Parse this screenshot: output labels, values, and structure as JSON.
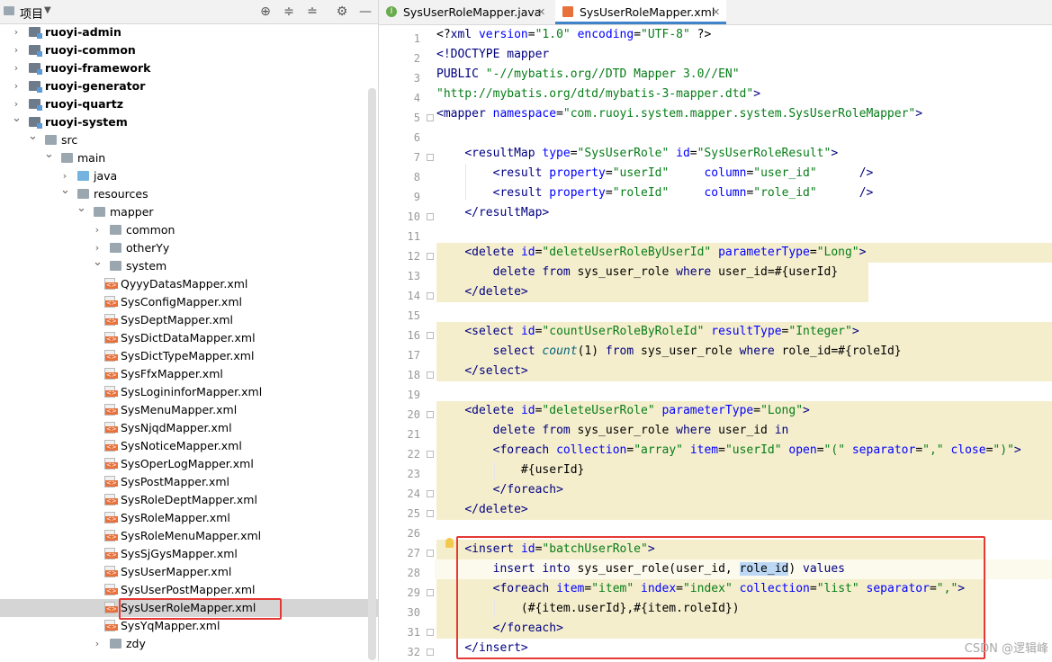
{
  "project_panel": {
    "title": "项目",
    "toolbar_icons": [
      "locate-icon",
      "expand-all-icon",
      "collapse-all-icon",
      "settings-icon",
      "hide-icon"
    ],
    "tree": [
      {
        "label": "ruoyi-admin",
        "level": 0,
        "kind": "module",
        "arrow": "right",
        "bold": true
      },
      {
        "label": "ruoyi-common",
        "level": 0,
        "kind": "module",
        "arrow": "right",
        "bold": true
      },
      {
        "label": "ruoyi-framework",
        "level": 0,
        "kind": "module",
        "arrow": "right",
        "bold": true
      },
      {
        "label": "ruoyi-generator",
        "level": 0,
        "kind": "module",
        "arrow": "right",
        "bold": true
      },
      {
        "label": "ruoyi-quartz",
        "level": 0,
        "kind": "module",
        "arrow": "right",
        "bold": true
      },
      {
        "label": "ruoyi-system",
        "level": 0,
        "kind": "module",
        "arrow": "down",
        "bold": true
      },
      {
        "label": "src",
        "level": 1,
        "kind": "folder",
        "arrow": "down"
      },
      {
        "label": "main",
        "level": 2,
        "kind": "folder",
        "arrow": "down"
      },
      {
        "label": "java",
        "level": 3,
        "kind": "folder-blue",
        "arrow": "right"
      },
      {
        "label": "resources",
        "level": 3,
        "kind": "folder-res",
        "arrow": "down"
      },
      {
        "label": "mapper",
        "level": 4,
        "kind": "folder",
        "arrow": "down"
      },
      {
        "label": "common",
        "level": 5,
        "kind": "folder",
        "arrow": "right"
      },
      {
        "label": "otherYy",
        "level": 5,
        "kind": "folder",
        "arrow": "right"
      },
      {
        "label": "system",
        "level": 5,
        "kind": "folder",
        "arrow": "down"
      },
      {
        "label": "QyyyDatasMapper.xml",
        "level": 6,
        "kind": "xml"
      },
      {
        "label": "SysConfigMapper.xml",
        "level": 6,
        "kind": "xml"
      },
      {
        "label": "SysDeptMapper.xml",
        "level": 6,
        "kind": "xml"
      },
      {
        "label": "SysDictDataMapper.xml",
        "level": 6,
        "kind": "xml"
      },
      {
        "label": "SysDictTypeMapper.xml",
        "level": 6,
        "kind": "xml"
      },
      {
        "label": "SysFfxMapper.xml",
        "level": 6,
        "kind": "xml"
      },
      {
        "label": "SysLogininforMapper.xml",
        "level": 6,
        "kind": "xml"
      },
      {
        "label": "SysMenuMapper.xml",
        "level": 6,
        "kind": "xml"
      },
      {
        "label": "SysNjqdMapper.xml",
        "level": 6,
        "kind": "xml"
      },
      {
        "label": "SysNoticeMapper.xml",
        "level": 6,
        "kind": "xml"
      },
      {
        "label": "SysOperLogMapper.xml",
        "level": 6,
        "kind": "xml"
      },
      {
        "label": "SysPostMapper.xml",
        "level": 6,
        "kind": "xml"
      },
      {
        "label": "SysRoleDeptMapper.xml",
        "level": 6,
        "kind": "xml"
      },
      {
        "label": "SysRoleMapper.xml",
        "level": 6,
        "kind": "xml"
      },
      {
        "label": "SysRoleMenuMapper.xml",
        "level": 6,
        "kind": "xml"
      },
      {
        "label": "SysSjGysMapper.xml",
        "level": 6,
        "kind": "xml"
      },
      {
        "label": "SysUserMapper.xml",
        "level": 6,
        "kind": "xml"
      },
      {
        "label": "SysUserPostMapper.xml",
        "level": 6,
        "kind": "xml"
      },
      {
        "label": "SysUserRoleMapper.xml",
        "level": 6,
        "kind": "xml",
        "selected": true
      },
      {
        "label": "SysYqMapper.xml",
        "level": 6,
        "kind": "xml"
      },
      {
        "label": "zdy",
        "level": 5,
        "kind": "folder",
        "arrow": "right"
      }
    ]
  },
  "tabs": [
    {
      "label": "SysUserRoleMapper.java",
      "icon": "java-class-icon",
      "active": false
    },
    {
      "label": "SysUserRoleMapper.xml",
      "icon": "xml-file-icon",
      "active": true
    }
  ],
  "code": [
    [
      [
        "pl",
        "<?"
      ],
      [
        "tag",
        "xml "
      ],
      [
        "attr",
        "version"
      ],
      [
        "pl",
        "="
      ],
      [
        "val",
        "\"1.0\""
      ],
      [
        "pl",
        " "
      ],
      [
        "attr",
        "encoding"
      ],
      [
        "pl",
        "="
      ],
      [
        "val",
        "\"UTF-8\""
      ],
      [
        "pl",
        " ?>"
      ]
    ],
    [
      [
        "tag",
        "<!DOCTYPE "
      ],
      [
        "tag",
        "mapper"
      ]
    ],
    [
      [
        "tag",
        "PUBLIC "
      ],
      [
        "val",
        "\"-//mybatis.org//DTD Mapper 3.0//EN\""
      ]
    ],
    [
      [
        "val",
        "\"http://mybatis.org/dtd/mybatis-3-mapper.dtd\""
      ],
      [
        "tag",
        ">"
      ]
    ],
    [
      [
        "tag",
        "<mapper "
      ],
      [
        "attr",
        "namespace"
      ],
      [
        "pl",
        "="
      ],
      [
        "val",
        "\"com.ruoyi.system.mapper.system.SysUserRoleMapper\""
      ],
      [
        "tag",
        ">"
      ]
    ],
    [],
    [
      [
        "pl",
        "    "
      ],
      [
        "tag",
        "<resultMap "
      ],
      [
        "attr",
        "type"
      ],
      [
        "pl",
        "="
      ],
      [
        "val",
        "\"SysUserRole\""
      ],
      [
        "pl",
        " "
      ],
      [
        "attr",
        "id"
      ],
      [
        "pl",
        "="
      ],
      [
        "val",
        "\"SysUserRoleResult\""
      ],
      [
        "tag",
        ">"
      ]
    ],
    [
      [
        "pl",
        "        "
      ],
      [
        "tag",
        "<result "
      ],
      [
        "attr",
        "property"
      ],
      [
        "pl",
        "="
      ],
      [
        "val",
        "\"userId\""
      ],
      [
        "pl",
        "     "
      ],
      [
        "attr",
        "column"
      ],
      [
        "pl",
        "="
      ],
      [
        "val",
        "\"user_id\""
      ],
      [
        "pl",
        "      "
      ],
      [
        "tag",
        "/>"
      ]
    ],
    [
      [
        "pl",
        "        "
      ],
      [
        "tag",
        "<result "
      ],
      [
        "attr",
        "property"
      ],
      [
        "pl",
        "="
      ],
      [
        "val",
        "\"roleId\""
      ],
      [
        "pl",
        "     "
      ],
      [
        "attr",
        "column"
      ],
      [
        "pl",
        "="
      ],
      [
        "val",
        "\"role_id\""
      ],
      [
        "pl",
        "      "
      ],
      [
        "tag",
        "/>"
      ]
    ],
    [
      [
        "pl",
        "    "
      ],
      [
        "tag",
        "</resultMap>"
      ]
    ],
    [],
    [
      [
        "pl",
        "    "
      ],
      [
        "tag",
        "<delete "
      ],
      [
        "attr",
        "id"
      ],
      [
        "pl",
        "="
      ],
      [
        "val",
        "\"deleteUserRoleByUserId\""
      ],
      [
        "pl",
        " "
      ],
      [
        "attr",
        "parameterType"
      ],
      [
        "pl",
        "="
      ],
      [
        "val",
        "\"Long\""
      ],
      [
        "tag",
        ">"
      ]
    ],
    [
      [
        "pl",
        "        "
      ],
      [
        "kw",
        "delete from "
      ],
      [
        "pl",
        "sys_user_role "
      ],
      [
        "kw",
        "where "
      ],
      [
        "pl",
        "user_id=#{userId}"
      ]
    ],
    [
      [
        "pl",
        "    "
      ],
      [
        "tag",
        "</delete>"
      ]
    ],
    [],
    [
      [
        "pl",
        "    "
      ],
      [
        "tag",
        "<select "
      ],
      [
        "attr",
        "id"
      ],
      [
        "pl",
        "="
      ],
      [
        "val",
        "\"countUserRoleByRoleId\""
      ],
      [
        "pl",
        " "
      ],
      [
        "attr",
        "resultType"
      ],
      [
        "pl",
        "="
      ],
      [
        "val",
        "\"Integer\""
      ],
      [
        "tag",
        ">"
      ]
    ],
    [
      [
        "pl",
        "        "
      ],
      [
        "kw",
        "select "
      ],
      [
        "fn",
        "count"
      ],
      [
        "pl",
        "(1) "
      ],
      [
        "kw",
        "from "
      ],
      [
        "pl",
        "sys_user_role "
      ],
      [
        "kw",
        "where "
      ],
      [
        "pl",
        "role_id=#{roleId}"
      ]
    ],
    [
      [
        "pl",
        "    "
      ],
      [
        "tag",
        "</select>"
      ]
    ],
    [],
    [
      [
        "pl",
        "    "
      ],
      [
        "tag",
        "<delete "
      ],
      [
        "attr",
        "id"
      ],
      [
        "pl",
        "="
      ],
      [
        "val",
        "\"deleteUserRole\""
      ],
      [
        "pl",
        " "
      ],
      [
        "attr",
        "parameterType"
      ],
      [
        "pl",
        "="
      ],
      [
        "val",
        "\"Long\""
      ],
      [
        "tag",
        ">"
      ]
    ],
    [
      [
        "pl",
        "        "
      ],
      [
        "kw",
        "delete from "
      ],
      [
        "pl",
        "sys_user_role "
      ],
      [
        "kw",
        "where "
      ],
      [
        "pl",
        "user_id "
      ],
      [
        "kw",
        "in"
      ]
    ],
    [
      [
        "pl",
        "        "
      ],
      [
        "tag",
        "<foreach "
      ],
      [
        "attr",
        "collection"
      ],
      [
        "pl",
        "="
      ],
      [
        "val",
        "\"array\""
      ],
      [
        "pl",
        " "
      ],
      [
        "attr",
        "item"
      ],
      [
        "pl",
        "="
      ],
      [
        "val",
        "\"userId\""
      ],
      [
        "pl",
        " "
      ],
      [
        "attr",
        "open"
      ],
      [
        "pl",
        "="
      ],
      [
        "val",
        "\"(\""
      ],
      [
        "pl",
        " "
      ],
      [
        "attr",
        "separator"
      ],
      [
        "pl",
        "="
      ],
      [
        "val",
        "\",\""
      ],
      [
        "pl",
        " "
      ],
      [
        "attr",
        "close"
      ],
      [
        "pl",
        "="
      ],
      [
        "val",
        "\")\""
      ],
      [
        "tag",
        ">"
      ]
    ],
    [
      [
        "pl",
        "            #{userId}"
      ]
    ],
    [
      [
        "pl",
        "        "
      ],
      [
        "tag",
        "</foreach>"
      ]
    ],
    [
      [
        "pl",
        "    "
      ],
      [
        "tag",
        "</delete>"
      ]
    ],
    [],
    [
      [
        "pl",
        "    "
      ],
      [
        "tag",
        "<insert "
      ],
      [
        "attr",
        "id"
      ],
      [
        "pl",
        "="
      ],
      [
        "val",
        "\"batchUserRole\""
      ],
      [
        "tag",
        ">"
      ]
    ],
    [
      [
        "pl",
        "        "
      ],
      [
        "kw",
        "insert into "
      ],
      [
        "pl",
        "sys_user_role(user_id, "
      ],
      [
        "sel",
        "role_id"
      ],
      [
        "pl",
        ") "
      ],
      [
        "kw",
        "values"
      ]
    ],
    [
      [
        "pl",
        "        "
      ],
      [
        "tag",
        "<foreach "
      ],
      [
        "attr",
        "item"
      ],
      [
        "pl",
        "="
      ],
      [
        "val",
        "\"item\""
      ],
      [
        "pl",
        " "
      ],
      [
        "attr",
        "index"
      ],
      [
        "pl",
        "="
      ],
      [
        "val",
        "\"index\""
      ],
      [
        "pl",
        " "
      ],
      [
        "attr",
        "collection"
      ],
      [
        "pl",
        "="
      ],
      [
        "val",
        "\"list\""
      ],
      [
        "pl",
        " "
      ],
      [
        "attr",
        "separator"
      ],
      [
        "pl",
        "="
      ],
      [
        "val",
        "\",\""
      ],
      [
        "tag",
        ">"
      ]
    ],
    [
      [
        "pl",
        "            (#{item.userId},#{item.roleId})"
      ]
    ],
    [
      [
        "pl",
        "        "
      ],
      [
        "tag",
        "</foreach>"
      ]
    ],
    [
      [
        "pl",
        "    "
      ],
      [
        "tag",
        "</insert>"
      ]
    ]
  ],
  "watermark": "CSDN @逻辑峰"
}
